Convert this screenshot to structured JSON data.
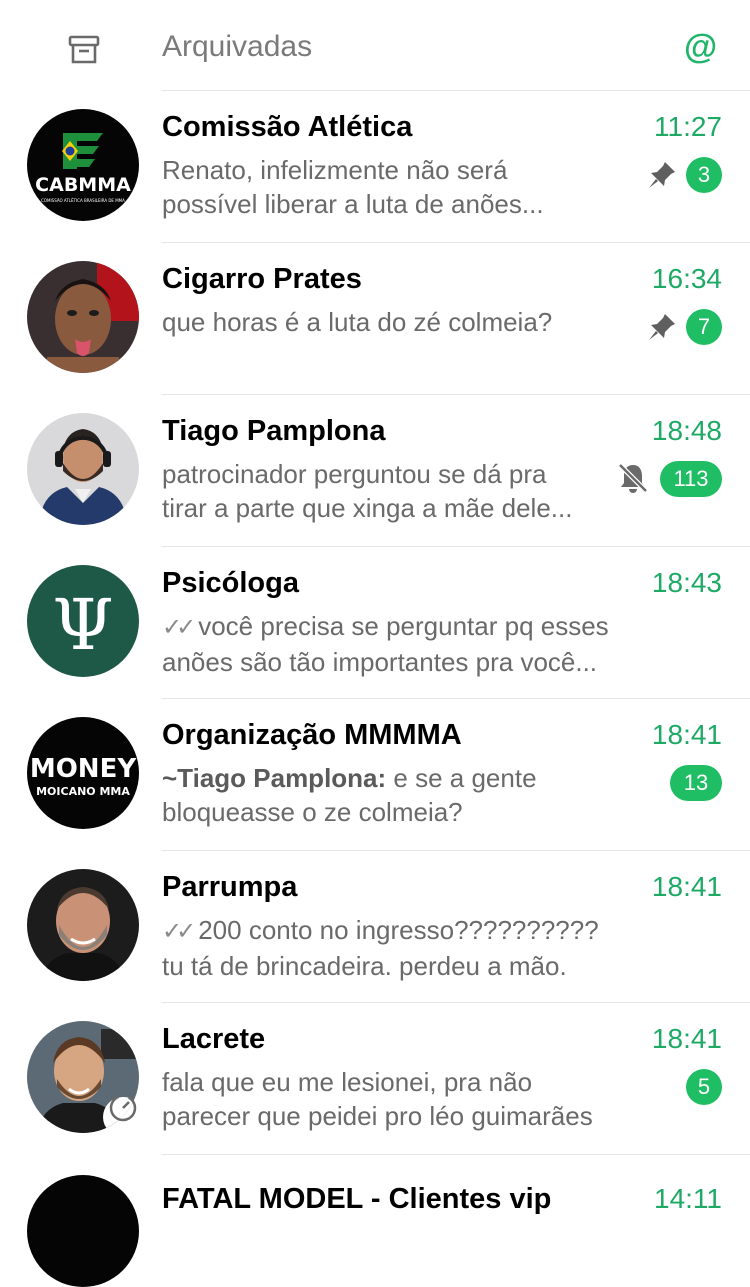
{
  "header": {
    "title": "Arquivadas",
    "archive_icon": "archive-box-icon",
    "mention_icon": "@"
  },
  "colors": {
    "accent": "#1fbe64",
    "time": "#1ea965",
    "preview": "#6a6a6a"
  },
  "chats": [
    {
      "avatar_text": "CABMMA",
      "avatar_subtext": "COMISSÃO ATLÉTICA BRASILEIRA DE MMA",
      "name": "Comissão Atlética",
      "time": "11:27",
      "line1": "Renato, infelizmente não será",
      "line2": "possível liberar a luta de anões...",
      "badge": "3",
      "pinned": true
    },
    {
      "name": "Cigarro Prates",
      "time": "16:34",
      "line1": "que horas é a luta do zé colmeia?",
      "badge": "7",
      "pinned": true
    },
    {
      "name": "Tiago Pamplona",
      "time": "18:48",
      "line1": "patrocinador perguntou se dá pra",
      "line2": "tirar a parte que xinga a mãe dele...",
      "badge": "113",
      "muted": true
    },
    {
      "avatar_text": "Ψ",
      "name": "Psicóloga",
      "time": "18:43",
      "ticks": "✓✓",
      "line1": "você precisa se perguntar pq esses",
      "line2": "anões são tão importantes pra você..."
    },
    {
      "avatar_text": "MONEY",
      "avatar_subtext": "MOICANO MMA",
      "name": "Organização MMMMA",
      "time": "18:41",
      "sender": "~Tiago Pamplona:",
      "line1": " e se a gente",
      "line2": "bloqueasse o ze colmeia?",
      "badge": "13"
    },
    {
      "name": "Parrumpa",
      "time": "18:41",
      "ticks": "✓✓",
      "line1": "200 conto no ingresso??????????",
      "line2": "tu tá de brincadeira. perdeu a mão."
    },
    {
      "name": "Lacrete",
      "time": "18:41",
      "line1": "fala que eu me lesionei, pra não",
      "line2": "parecer que peidei pro léo guimarães",
      "badge": "5"
    },
    {
      "name": "FATAL MODEL - Clientes vip",
      "time": "14:11"
    }
  ]
}
